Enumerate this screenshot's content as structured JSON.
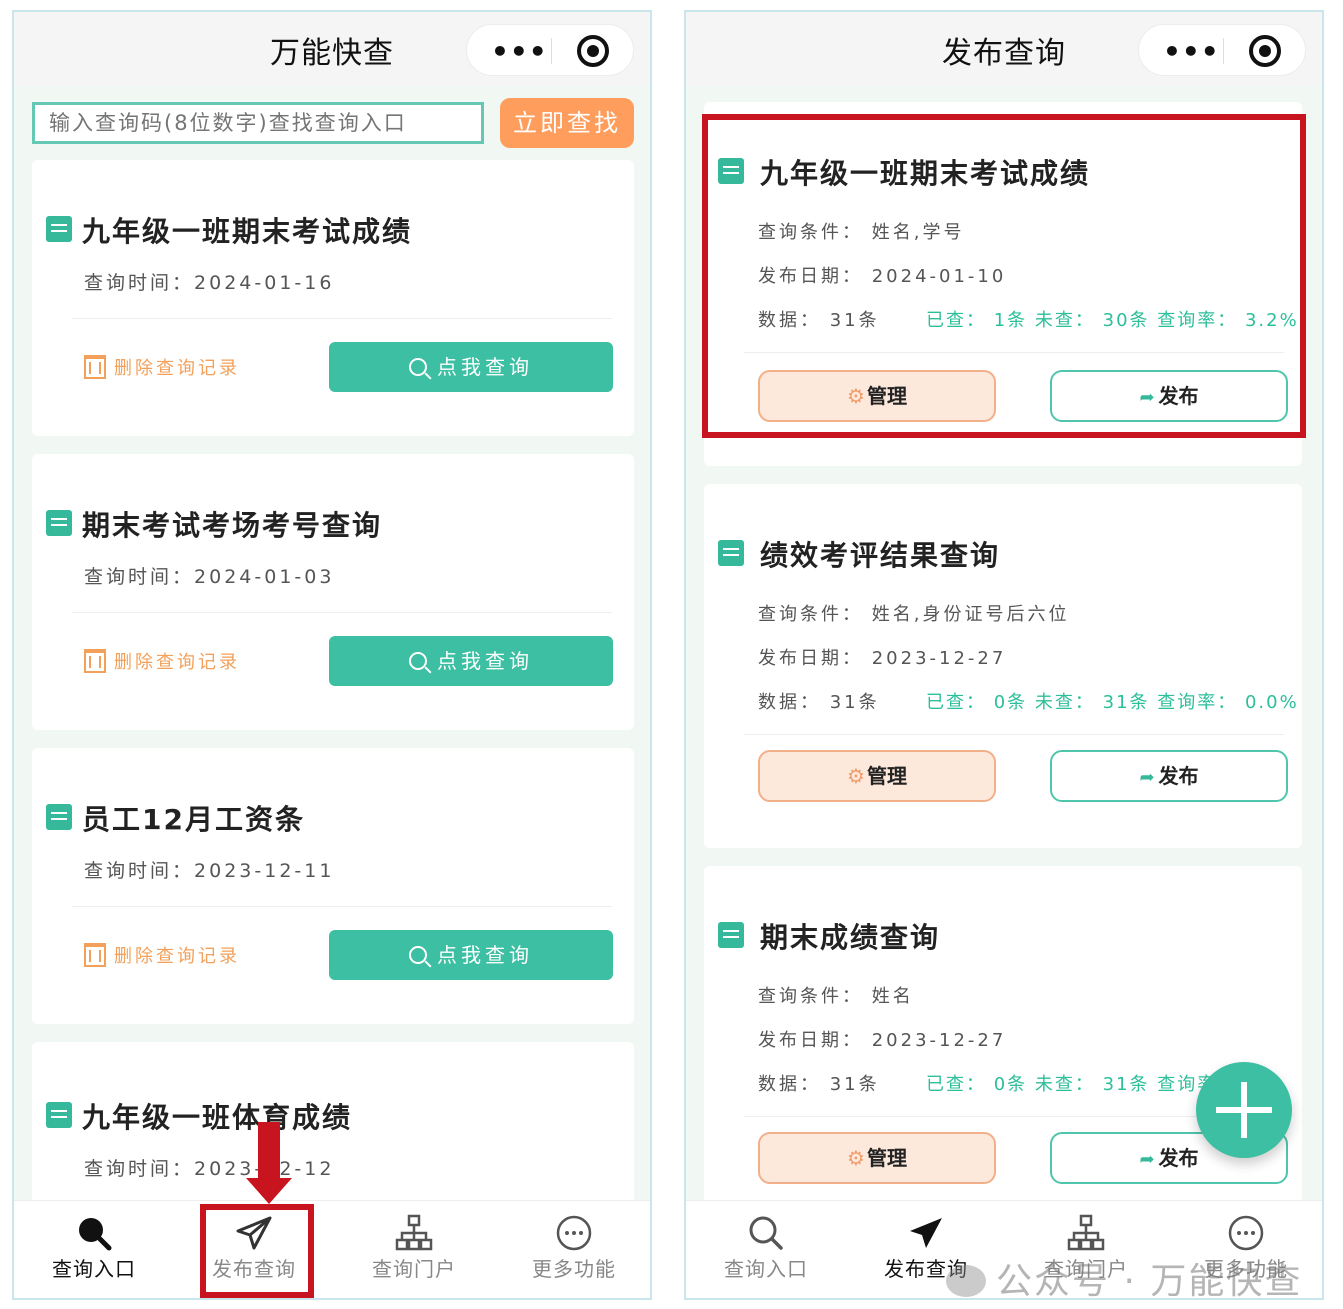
{
  "left": {
    "title": "万能快查",
    "search": {
      "placeholder": "输入查询码(8位数字)查找查询入口",
      "button": "立即查找"
    },
    "cards": [
      {
        "title": "九年级一班期末考试成绩",
        "time_label": "查询时间：",
        "time": "2024-01-16",
        "delete": "删除查询记录",
        "query": "点我查询"
      },
      {
        "title": "期末考试考场考号查询",
        "time_label": "查询时间：",
        "time": "2024-01-03",
        "delete": "删除查询记录",
        "query": "点我查询"
      },
      {
        "title": "员工12月工资条",
        "time_label": "查询时间：",
        "time": "2023-12-11",
        "delete": "删除查询记录",
        "query": "点我查询"
      },
      {
        "title": "九年级一班体育成绩",
        "time_label": "查询时间：",
        "time": "2023-12-12"
      }
    ],
    "tabs": [
      {
        "label": "查询入口",
        "icon": "search-icon"
      },
      {
        "label": "发布查询",
        "icon": "send-icon"
      },
      {
        "label": "查询门户",
        "icon": "org-chart-icon"
      },
      {
        "label": "更多功能",
        "icon": "more-icon"
      }
    ]
  },
  "right": {
    "title": "发布查询",
    "cards": [
      {
        "title": "九年级一班期末考试成绩",
        "cond": "查询条件：  姓名,学号",
        "date": "发布日期：  2024-01-10",
        "data": "数据：  31条",
        "stat": "已查：  1条  未查：  30条  查询率：  3.2%",
        "manage": "管理",
        "publish": "发布"
      },
      {
        "title": "绩效考评结果查询",
        "cond": "查询条件：  姓名,身份证号后六位",
        "date": "发布日期：  2023-12-27",
        "data": "数据：  31条",
        "stat": "已查：  0条  未查：  31条  查询率：  0.0%",
        "manage": "管理",
        "publish": "发布"
      },
      {
        "title": "期末成绩查询",
        "cond": "查询条件：  姓名",
        "date": "发布日期：  2023-12-27",
        "data": "数据：  31条",
        "stat": "已查：  0条  未查：  31条  查询率",
        "manage": "管理",
        "publish": "发布"
      }
    ],
    "tabs": [
      {
        "label": "查询入口",
        "icon": "search-icon"
      },
      {
        "label": "发布查询",
        "icon": "send-icon"
      },
      {
        "label": "查询门户",
        "icon": "org-chart-icon"
      },
      {
        "label": "更多功能",
        "icon": "more-icon"
      }
    ]
  },
  "watermark": "公众号 · 万能快查",
  "colors": {
    "accent": "#3cbfa2",
    "orange": "#ff9d5c",
    "highlight": "#c8141e"
  }
}
